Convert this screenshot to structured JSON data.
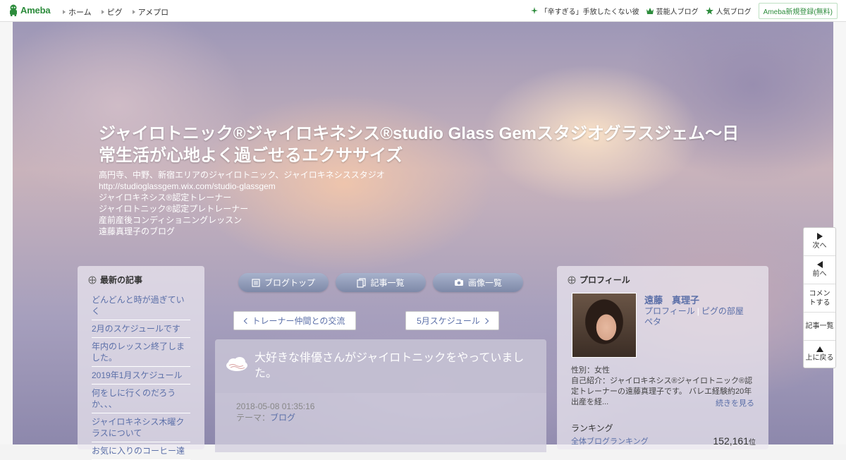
{
  "topbar": {
    "logo_text": "Ameba",
    "nav": [
      "ホーム",
      "ピグ",
      "アメプロ"
    ],
    "links": [
      {
        "icon": "sparkle-icon",
        "label": "「辛すぎる」手放したくない彼"
      },
      {
        "icon": "crown-icon",
        "label": "芸能人ブログ"
      },
      {
        "icon": "star-icon",
        "label": "人気ブログ"
      }
    ],
    "register_label": "Ameba新規登録(無料)",
    "brand_color": "#2d8c3c"
  },
  "header": {
    "title": "ジャイロトニック®ジャイロキネシス®studio Glass Gemスタジオグラスジェム〜日常生活が心地よく過ごせるエクササイズ",
    "description": [
      "高円寺、中野、新宿エリアのジャイロトニック、ジャイロキネシススタジオ",
      "http://studioglassgem.wix.com/studio-glassgem",
      "ジャイロキネシス®認定トレーナー",
      "ジャイロトニック®認定プレトレーナー",
      "産前産後コンディショニングレッスン",
      "遠藤真理子のブログ"
    ]
  },
  "left_sidebar": {
    "heading": "最新の記事",
    "items": [
      "どんどんと時が過ぎていく",
      "2月のスケジュールです",
      "年内のレッスン終了しました。",
      "2019年1月スケジュール",
      "何をしに行くのだろうか、、、",
      "ジャイロキネシス木曜クラスについて",
      "お気に入りのコーヒー達"
    ]
  },
  "center": {
    "tabs": [
      {
        "icon": "document-icon",
        "label": "ブログトップ"
      },
      {
        "icon": "pages-icon",
        "label": "記事一覧"
      },
      {
        "icon": "camera-icon",
        "label": "画像一覧"
      }
    ],
    "prev_link": "トレーナー仲間との交流",
    "next_link": "5月スケジュール",
    "article": {
      "title": "大好きな俳優さんがジャイロトニックをやっていました。",
      "date": "2018-05-08 01:35:16",
      "theme_label": "テーマ：",
      "theme_value": "ブログ"
    }
  },
  "profile": {
    "heading": "プロフィール",
    "name": "遠藤　真理子",
    "links": [
      "プロフィール",
      "ピグの部屋",
      "ペタ"
    ],
    "gender": "性別：女性",
    "intro": "自己紹介：ジャイロキネシス®ジャイロトニック®認定トレーナーの遠藤真理子です。 バレエ経験約20年 出産を経...",
    "more_label": "続きを見る",
    "ranking_title": "ランキング",
    "ranking_label": "全体ブログランキング",
    "ranking_value": "152,161",
    "ranking_unit": "位"
  },
  "sidenav": {
    "next": "次へ",
    "prev": "前へ",
    "comment": "コメントする",
    "list": "記事一覧",
    "top": "上に戻る"
  }
}
